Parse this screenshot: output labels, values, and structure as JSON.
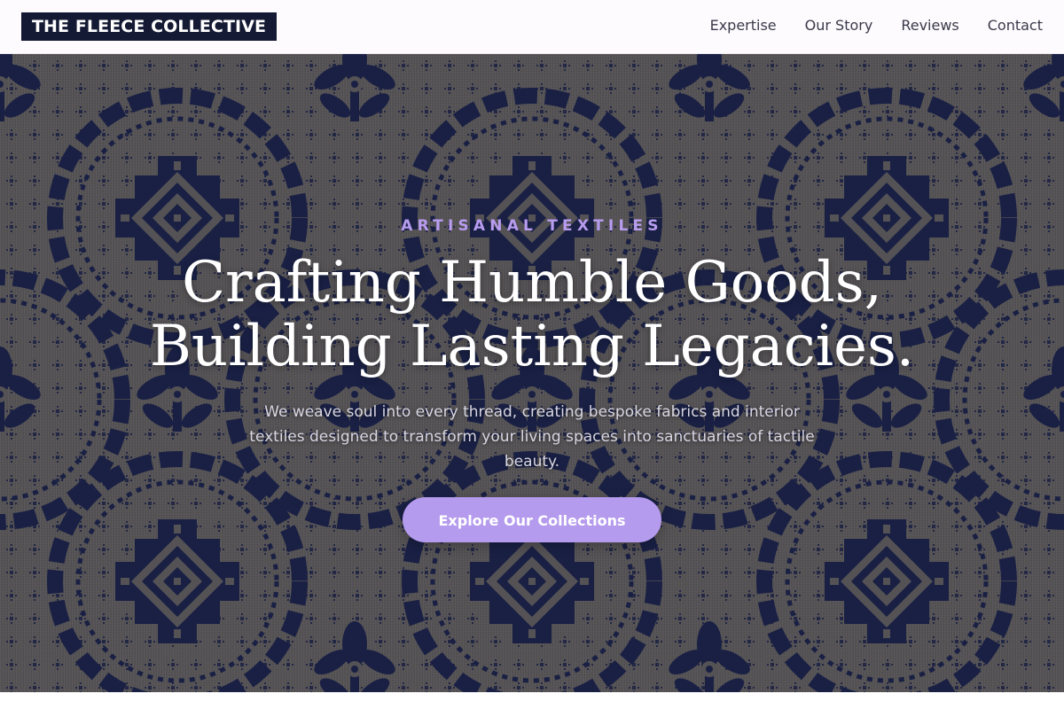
{
  "brand": {
    "logo_text": "THE FLEECE COLLECTIVE"
  },
  "nav": {
    "items": [
      {
        "label": "Expertise"
      },
      {
        "label": "Our Story"
      },
      {
        "label": "Reviews"
      },
      {
        "label": "Contact"
      }
    ]
  },
  "hero": {
    "eyebrow": "ARTISANAL TEXTILES",
    "headline_line1": "Crafting Humble Goods,",
    "headline_line2": "Building Lasting Legacies.",
    "subtext": "We weave soul into every thread, creating bespoke fabrics and interior textiles designed to transform your living spaces into sanctuaries of tactile beauty.",
    "cta_label": "Explore Our Collections",
    "background_image": "navy-damask-woven-textile-pattern"
  },
  "colors": {
    "logo_bg": "#141a33",
    "accent": "#b59bee",
    "eyebrow": "#b89cf0",
    "pattern_navy": "#1b2148",
    "pattern_ground": "#5e5a5a"
  }
}
